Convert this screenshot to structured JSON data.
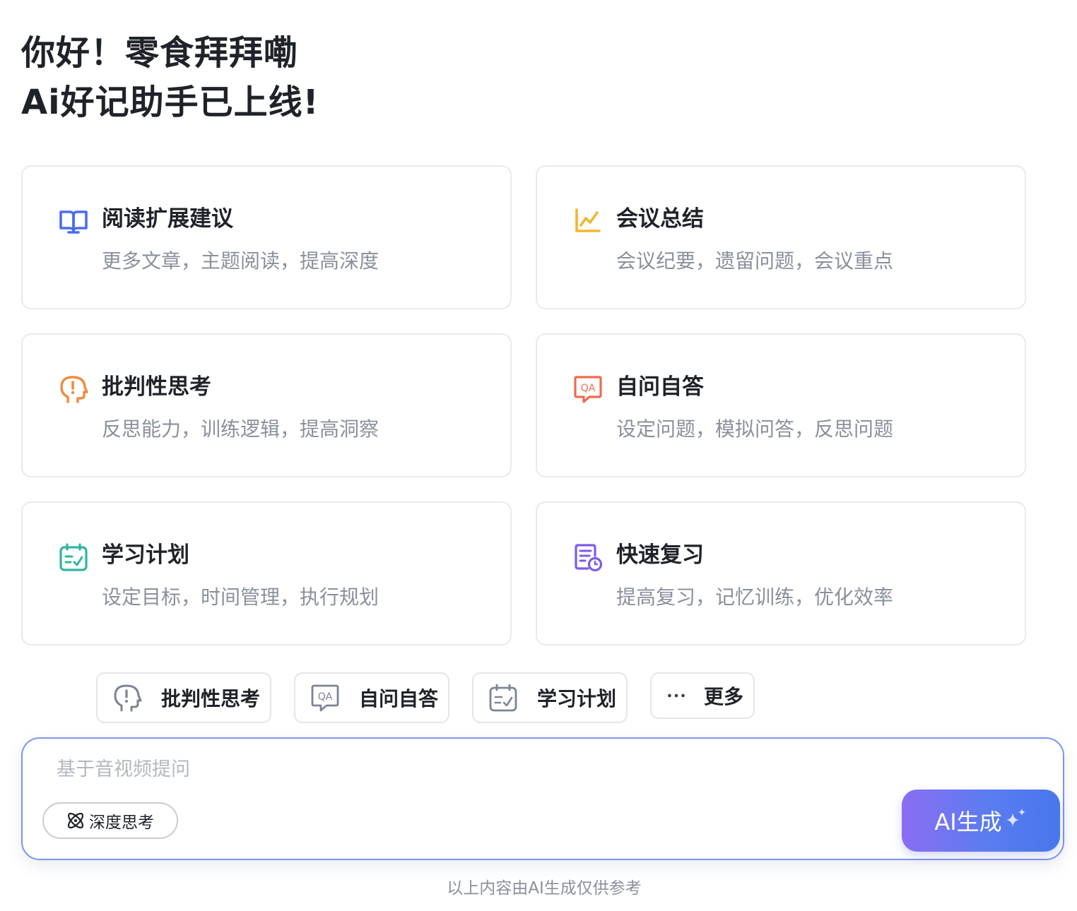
{
  "greeting": {
    "line1": "你好！零食拜拜嘞",
    "line2": "Ai好记助手已上线!"
  },
  "cards": [
    {
      "title": "阅读扩展建议",
      "desc": "更多文章，主题阅读，提高深度",
      "icon": "book-open-icon",
      "color": "#4a6cf0"
    },
    {
      "title": "会议总结",
      "desc": "会议纪要，遗留问题，会议重点",
      "icon": "line-chart-icon",
      "color": "#f2b632"
    },
    {
      "title": "批判性思考",
      "desc": "反思能力，训练逻辑，提高洞察",
      "icon": "head-exclamation-icon",
      "color": "#f08a3e"
    },
    {
      "title": "自问自答",
      "desc": "设定问题，模拟问答，反思问题",
      "icon": "qa-bubble-icon",
      "color": "#ef6b4f"
    },
    {
      "title": "学习计划",
      "desc": "设定目标，时间管理，执行规划",
      "icon": "calendar-check-icon",
      "color": "#2fb5a0"
    },
    {
      "title": "快速复习",
      "desc": "提高复习，记忆训练，优化效率",
      "icon": "document-clock-icon",
      "color": "#7c5ce8"
    }
  ],
  "chips": [
    {
      "label": "批判性思考",
      "icon": "head-exclamation-icon"
    },
    {
      "label": "自问自答",
      "icon": "qa-bubble-icon"
    },
    {
      "label": "学习计划",
      "icon": "calendar-check-icon"
    },
    {
      "label": "更多",
      "icon": "more-dots-icon"
    }
  ],
  "input": {
    "placeholder": "基于音视频提问",
    "value": ""
  },
  "deep_think": {
    "label": "深度思考",
    "icon": "atom-icon"
  },
  "ai_button": {
    "label": "AI生成",
    "icon": "sparkle-icon"
  },
  "footer": {
    "note": "以上内容由AI生成仅供参考"
  },
  "colors": {
    "accent_gradient_start": "#8b6df2",
    "accent_gradient_end": "#4777ec",
    "input_border": "#7b95ec",
    "muted_text": "#8a909c"
  }
}
